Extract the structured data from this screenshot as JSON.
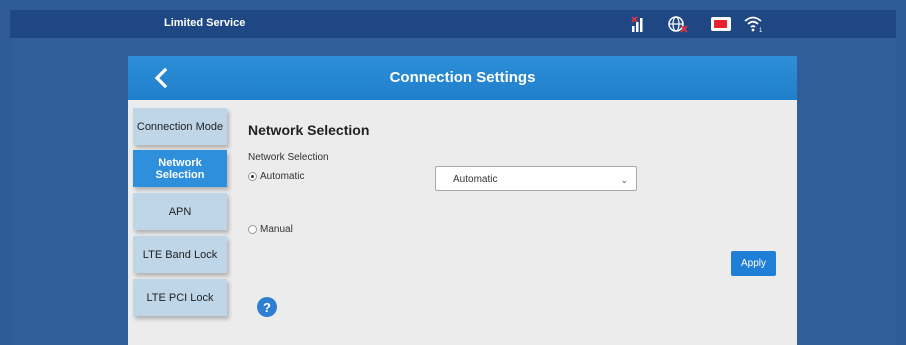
{
  "status_bar": {
    "service_text": "Limited Service",
    "icons": [
      "signal-icon",
      "roaming-icon",
      "sim-icon",
      "wifi-icon"
    ]
  },
  "header": {
    "title": "Connection Settings",
    "back_icon": "chevron-left-icon"
  },
  "sidebar": {
    "items": [
      {
        "label": "Connection Mode"
      },
      {
        "label": "Network Selection"
      },
      {
        "label": "APN"
      },
      {
        "label": "LTE Band Lock"
      },
      {
        "label": "LTE PCI Lock"
      }
    ],
    "active_index": 1
  },
  "main": {
    "section_title": "Network Selection",
    "field_label": "Network Selection",
    "options": [
      {
        "label": "Automatic",
        "checked": true
      },
      {
        "label": "Manual",
        "checked": false
      }
    ],
    "select_value": "Automatic",
    "apply_label": "Apply",
    "help_label": "?"
  },
  "colors": {
    "header_blue": "#2e8fd8",
    "active_nav": "#2e8fdc",
    "nav_bg": "#bfd6e8",
    "background": "#2f5b96"
  }
}
